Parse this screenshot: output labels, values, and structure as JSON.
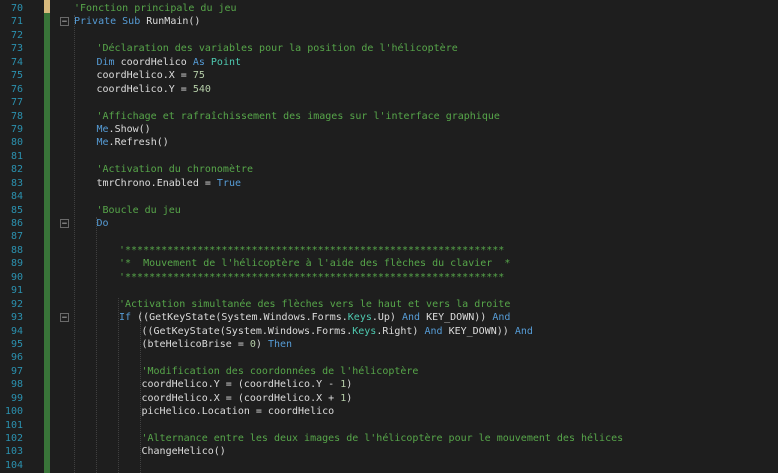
{
  "editor": {
    "lines": [
      {
        "n": "70",
        "indent": 0,
        "tokens": [
          {
            "c": "cm",
            "t": "'Fonction principale du jeu"
          }
        ]
      },
      {
        "n": "71",
        "indent": 0,
        "tokens": [
          {
            "c": "kw",
            "t": "Private Sub "
          },
          {
            "c": "tx",
            "t": "RunMain()"
          }
        ]
      },
      {
        "n": "72",
        "indent": 0,
        "tokens": []
      },
      {
        "n": "73",
        "indent": 1,
        "tokens": [
          {
            "c": "cm",
            "t": "'Déclaration des variables pour la position de l'hélicoptère"
          }
        ]
      },
      {
        "n": "74",
        "indent": 1,
        "tokens": [
          {
            "c": "kw",
            "t": "Dim "
          },
          {
            "c": "tx",
            "t": "coordHelico "
          },
          {
            "c": "kw",
            "t": "As "
          },
          {
            "c": "ty",
            "t": "Point"
          }
        ]
      },
      {
        "n": "75",
        "indent": 1,
        "tokens": [
          {
            "c": "tx",
            "t": "coordHelico.X = "
          },
          {
            "c": "nm",
            "t": "75"
          }
        ]
      },
      {
        "n": "76",
        "indent": 1,
        "tokens": [
          {
            "c": "tx",
            "t": "coordHelico.Y = "
          },
          {
            "c": "nm",
            "t": "540"
          }
        ]
      },
      {
        "n": "77",
        "indent": 1,
        "tokens": []
      },
      {
        "n": "78",
        "indent": 1,
        "tokens": [
          {
            "c": "cm",
            "t": "'Affichage et rafraîchissement des images sur l'interface graphique"
          }
        ]
      },
      {
        "n": "79",
        "indent": 1,
        "tokens": [
          {
            "c": "kw",
            "t": "Me"
          },
          {
            "c": "tx",
            "t": ".Show()"
          }
        ]
      },
      {
        "n": "80",
        "indent": 1,
        "tokens": [
          {
            "c": "kw",
            "t": "Me"
          },
          {
            "c": "tx",
            "t": ".Refresh()"
          }
        ]
      },
      {
        "n": "81",
        "indent": 1,
        "tokens": []
      },
      {
        "n": "82",
        "indent": 1,
        "tokens": [
          {
            "c": "cm",
            "t": "'Activation du chronomètre"
          }
        ]
      },
      {
        "n": "83",
        "indent": 1,
        "tokens": [
          {
            "c": "tx",
            "t": "tmrChrono.Enabled = "
          },
          {
            "c": "kw",
            "t": "True"
          }
        ]
      },
      {
        "n": "84",
        "indent": 1,
        "tokens": []
      },
      {
        "n": "85",
        "indent": 1,
        "tokens": [
          {
            "c": "cm",
            "t": "'Boucle du jeu"
          }
        ]
      },
      {
        "n": "86",
        "indent": 1,
        "tokens": [
          {
            "c": "kw",
            "t": "Do"
          }
        ]
      },
      {
        "n": "87",
        "indent": 2,
        "tokens": []
      },
      {
        "n": "88",
        "indent": 2,
        "tokens": [
          {
            "c": "cm",
            "t": "'***************************************************************"
          }
        ]
      },
      {
        "n": "89",
        "indent": 2,
        "tokens": [
          {
            "c": "cm",
            "t": "'*  Mouvement de l'hélicoptère à l'aide des flèches du clavier  *"
          }
        ]
      },
      {
        "n": "90",
        "indent": 2,
        "tokens": [
          {
            "c": "cm",
            "t": "'***************************************************************"
          }
        ]
      },
      {
        "n": "91",
        "indent": 2,
        "tokens": []
      },
      {
        "n": "92",
        "indent": 2,
        "tokens": [
          {
            "c": "cm",
            "t": "'Activation simultanée des flèches vers le haut et vers la droite"
          }
        ]
      },
      {
        "n": "93",
        "indent": 2,
        "tokens": [
          {
            "c": "kw",
            "t": "If "
          },
          {
            "c": "tx",
            "t": "((GetKeyState(System.Windows.Forms."
          },
          {
            "c": "ty",
            "t": "Keys"
          },
          {
            "c": "tx",
            "t": ".Up) "
          },
          {
            "c": "kw",
            "t": "And "
          },
          {
            "c": "tx",
            "t": "KEY_DOWN)) "
          },
          {
            "c": "kw",
            "t": "And"
          }
        ]
      },
      {
        "n": "94",
        "indent": 3,
        "tokens": [
          {
            "c": "tx",
            "t": "((GetKeyState(System.Windows.Forms."
          },
          {
            "c": "ty",
            "t": "Keys"
          },
          {
            "c": "tx",
            "t": ".Right) "
          },
          {
            "c": "kw",
            "t": "And "
          },
          {
            "c": "tx",
            "t": "KEY_DOWN)) "
          },
          {
            "c": "kw",
            "t": "And"
          }
        ]
      },
      {
        "n": "95",
        "indent": 3,
        "tokens": [
          {
            "c": "tx",
            "t": "(bteHelicoBrise = "
          },
          {
            "c": "nm",
            "t": "0"
          },
          {
            "c": "tx",
            "t": ") "
          },
          {
            "c": "kw",
            "t": "Then"
          }
        ]
      },
      {
        "n": "96",
        "indent": 3,
        "tokens": []
      },
      {
        "n": "97",
        "indent": 3,
        "tokens": [
          {
            "c": "cm",
            "t": "'Modification des coordonnées de l'hélicoptère"
          }
        ]
      },
      {
        "n": "98",
        "indent": 3,
        "tokens": [
          {
            "c": "tx",
            "t": "coordHelico.Y = (coordHelico.Y - "
          },
          {
            "c": "nm",
            "t": "1"
          },
          {
            "c": "tx",
            "t": ")"
          }
        ]
      },
      {
        "n": "99",
        "indent": 3,
        "tokens": [
          {
            "c": "tx",
            "t": "coordHelico.X = (coordHelico.X + "
          },
          {
            "c": "nm",
            "t": "1"
          },
          {
            "c": "tx",
            "t": ")"
          }
        ]
      },
      {
        "n": "100",
        "indent": 3,
        "tokens": [
          {
            "c": "tx",
            "t": "picHelico.Location = coordHelico"
          }
        ]
      },
      {
        "n": "101",
        "indent": 3,
        "tokens": []
      },
      {
        "n": "102",
        "indent": 3,
        "tokens": [
          {
            "c": "cm",
            "t": "'Alternance entre les deux images de l'hélicoptère pour le mouvement des hélices"
          }
        ]
      },
      {
        "n": "103",
        "indent": 3,
        "tokens": [
          {
            "c": "tx",
            "t": "ChangeHelico()"
          }
        ]
      },
      {
        "n": "104",
        "indent": 3,
        "tokens": []
      }
    ]
  },
  "theme": {
    "background": "#1e1e1e",
    "line_number": "#2b91af",
    "comment": "#57a64a",
    "keyword": "#569cd6",
    "text": "#dcdcdc",
    "number": "#b5cea8",
    "type": "#4ec9b0"
  }
}
